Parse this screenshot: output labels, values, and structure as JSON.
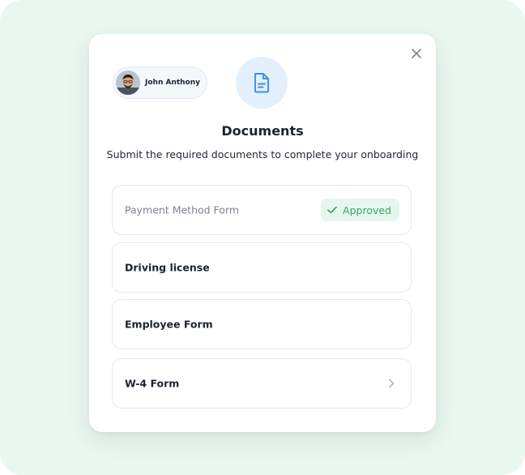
{
  "user": {
    "name": "John Anthony"
  },
  "header": {
    "title": "Documents",
    "subtitle": "Submit the required documents to complete your onboarding"
  },
  "icons": {
    "close": "close-icon",
    "document": "document-icon",
    "check": "check-icon",
    "chevron": "chevron-right-icon"
  },
  "colors": {
    "background": "#eaf7f1",
    "accent_blue": "#3b8fe6",
    "approved_green": "#2fa96b",
    "approved_bg": "#e6f6ee"
  },
  "documents": [
    {
      "label": "Payment Method Form",
      "status": "Approved"
    },
    {
      "label": "Driving license"
    },
    {
      "label": "Employee Form"
    },
    {
      "label": "W-4 Form"
    }
  ]
}
